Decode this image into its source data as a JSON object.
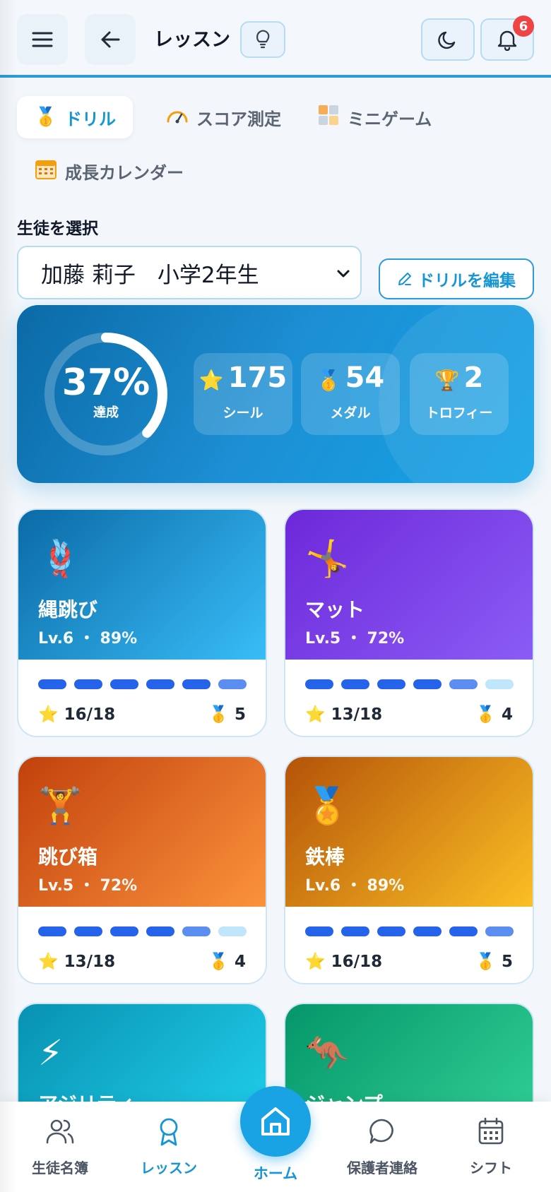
{
  "header": {
    "title": "レッスン",
    "notification_count": "6",
    "icons": [
      "menu-icon",
      "back-arrow-icon",
      "lightbulb-icon",
      "moon-icon",
      "bell-icon"
    ]
  },
  "tabs": [
    {
      "label": "ドリル",
      "icon": "medal-icon",
      "active": true
    },
    {
      "label": "スコア測定",
      "icon": "gauge-icon",
      "active": false
    },
    {
      "label": "ミニゲーム",
      "icon": "grid-icon",
      "active": false
    },
    {
      "label": "成長カレンダー",
      "icon": "calendar-icon",
      "active": false
    }
  ],
  "student_select": {
    "label": "生徒を選択",
    "selected": "加藤 莉子　小学2年生"
  },
  "edit_button": {
    "label": "ドリルを編集"
  },
  "summary": {
    "achievement_percent": 37,
    "achievement_text": "37%",
    "achievement_label": "達成",
    "stats": [
      {
        "icon": "star-icon",
        "glyph": "⭐",
        "value": "175",
        "label": "シール"
      },
      {
        "icon": "medal-icon",
        "glyph": "🥇",
        "value": "54",
        "label": "メダル"
      },
      {
        "icon": "trophy-icon",
        "glyph": "🏆",
        "value": "2",
        "label": "トロフィー"
      }
    ]
  },
  "drills": [
    {
      "name": "縄跳び",
      "emoji": "🪢",
      "level": "Lv.6 ・ 89%",
      "stars": "16/18",
      "medals": "5",
      "segments": [
        1,
        1,
        1,
        1,
        1,
        0.5
      ],
      "gradient": [
        "#0b6aa6",
        "#38bdf8"
      ]
    },
    {
      "name": "マット",
      "emoji": "🤸",
      "level": "Lv.5 ・ 72%",
      "stars": "13/18",
      "medals": "4",
      "segments": [
        1,
        1,
        1,
        1,
        0.5,
        0
      ],
      "gradient": [
        "#6d28d9",
        "#8b5cf6"
      ]
    },
    {
      "name": "跳び箱",
      "emoji": "🏋️",
      "level": "Lv.5 ・ 72%",
      "stars": "13/18",
      "medals": "4",
      "segments": [
        1,
        1,
        1,
        1,
        0.5,
        0
      ],
      "gradient": [
        "#c2410c",
        "#fb923c"
      ]
    },
    {
      "name": "鉄棒",
      "emoji": "🏅",
      "level": "Lv.6 ・ 89%",
      "stars": "16/18",
      "medals": "5",
      "segments": [
        1,
        1,
        1,
        1,
        1,
        0.5
      ],
      "gradient": [
        "#b45309",
        "#fbbf24"
      ]
    },
    {
      "name": "アジリティ",
      "emoji": "⚡",
      "level": "",
      "stars": "",
      "medals": "",
      "segments": [],
      "gradient": [
        "#0891b2",
        "#22d3ee"
      ]
    },
    {
      "name": "ジャンプ",
      "emoji": "🦘",
      "level": "",
      "stars": "",
      "medals": "",
      "segments": [],
      "gradient": [
        "#059669",
        "#34d399"
      ]
    }
  ],
  "bottom_nav": [
    {
      "label": "生徒名簿",
      "icon": "users-icon"
    },
    {
      "label": "レッスン",
      "icon": "ribbon-icon",
      "active": true
    },
    {
      "label": "ホーム",
      "icon": "home-icon"
    },
    {
      "label": "保護者連絡",
      "icon": "chat-icon"
    },
    {
      "label": "シフト",
      "icon": "calendar-icon"
    }
  ],
  "colors": {
    "accent": "#1595d6",
    "bar_full": "#2563eb",
    "bar_half": "#5b8ef0",
    "bar_empty": "#bfe6fb",
    "badge": "#ef4444"
  }
}
